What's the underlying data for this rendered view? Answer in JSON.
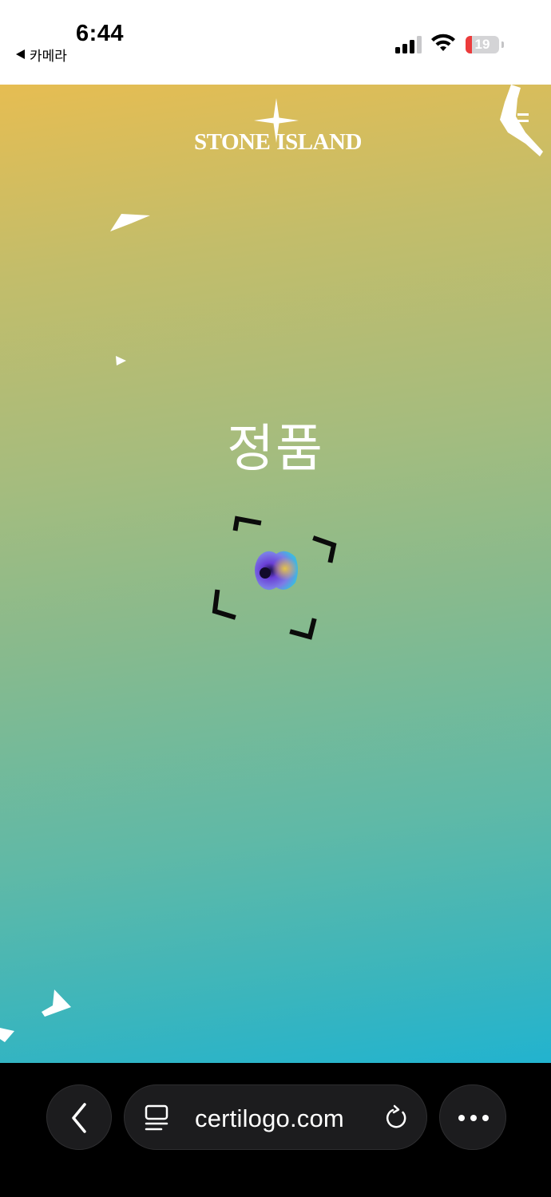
{
  "status_bar": {
    "time": "6:44",
    "back_app": "카메라",
    "battery_level": "19",
    "battery_fraction": 0.19
  },
  "page": {
    "brand": {
      "word1": "STONE",
      "word2": "ISLAND"
    },
    "result_text": "정품",
    "colors": {
      "gradient_top": "#e6bd52",
      "gradient_bottom": "#22b3cf"
    }
  },
  "browser": {
    "url": "certilogo.com",
    "icons": {
      "back": "chevron-left-icon",
      "reader": "reader-mode-icon",
      "reload": "reload-icon",
      "more": "more-dots-icon"
    }
  }
}
